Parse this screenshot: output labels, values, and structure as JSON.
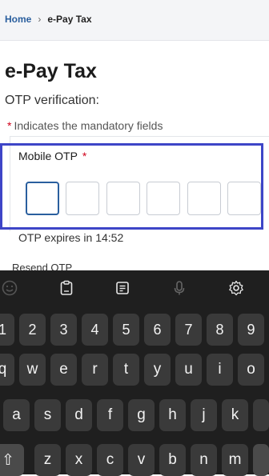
{
  "breadcrumb": {
    "home": "Home",
    "separator": "›",
    "current": "e-Pay Tax"
  },
  "page": {
    "title": "e-Pay Tax",
    "subtitle": "OTP verification:",
    "mandatory_star": "*",
    "mandatory_note": "Indicates the mandatory fields"
  },
  "otp": {
    "label": "Mobile OTP",
    "required_star": "*",
    "box_count": 6,
    "expires_text": "OTP expires in 14:52",
    "resend_text": "Resend OTP"
  },
  "keyboard": {
    "toolbar_icons": [
      "emoji-icon",
      "clipboard-icon",
      "sticker-icon",
      "microphone-icon",
      "settings-icon"
    ],
    "row_numbers": [
      "1",
      "2",
      "3",
      "4",
      "5",
      "6",
      "7",
      "8",
      "9"
    ],
    "row_top": [
      "q",
      "w",
      "e",
      "r",
      "t",
      "y",
      "u",
      "i",
      "o"
    ],
    "row_middle": [
      "a",
      "s",
      "d",
      "f",
      "g",
      "h",
      "j",
      "k"
    ],
    "row_bottom": [
      "z",
      "x",
      "c",
      "v",
      "b",
      "n",
      "m"
    ],
    "shift_label": "⇧"
  },
  "colors": {
    "highlight_border": "#3e45c7",
    "link_blue": "#2a5f9e",
    "required_red": "#d0021b",
    "keyboard_bg": "#1f1f1f",
    "key_bg": "#3a3a3a"
  }
}
